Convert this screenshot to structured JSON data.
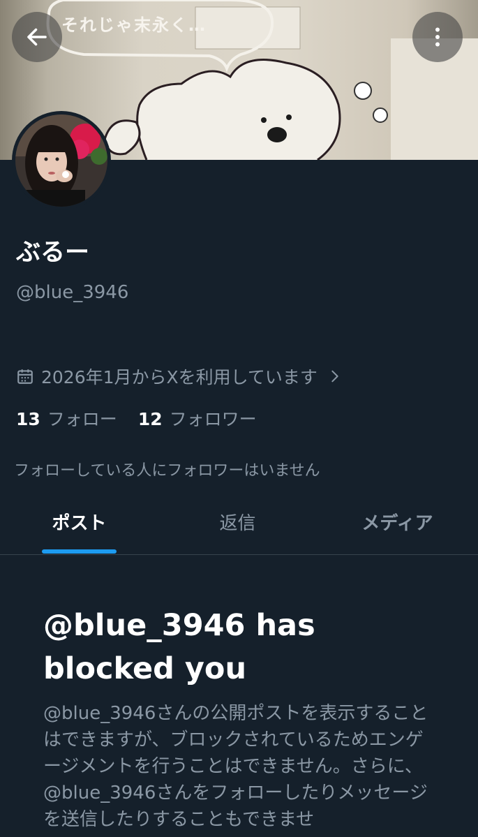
{
  "header": {
    "back_icon": "arrow-left-icon",
    "more_icon": "more-vertical-icon",
    "banner_caption": "それじゃ末永く…"
  },
  "profile": {
    "display_name": "ぶるー",
    "handle": "@blue_3946",
    "joined": "2026年1月からXを利用しています",
    "following_count": "13",
    "following_label": "フォロー",
    "followers_count": "12",
    "followers_label": "フォロワー",
    "no_mutual_followers": "フォローしている人にフォロワーはいません"
  },
  "tabs": [
    {
      "label": "ポスト",
      "active": true
    },
    {
      "label": "返信",
      "active": false
    },
    {
      "label": "メディア",
      "active": false
    }
  ],
  "blocked": {
    "title": "@blue_3946 has blocked you",
    "description": "@blue_3946さんの公開ポストを表示することはできますが、ブロックされているためエンゲージメントを行うことはできません。さらに、@blue_3946さんをフォローしたりメッセージを送信したりすることもできませ"
  },
  "colors": {
    "background": "#15202b",
    "accent": "#1d9bf0",
    "secondary_text": "#8b98a5"
  }
}
